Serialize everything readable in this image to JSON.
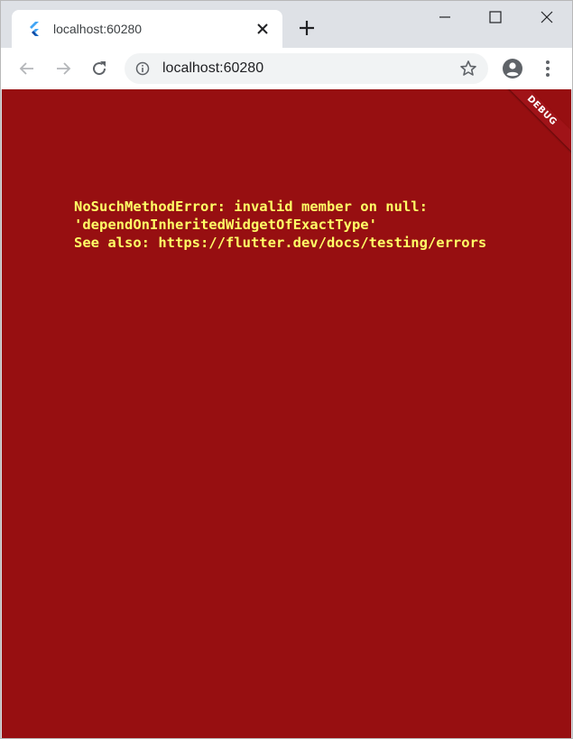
{
  "browser": {
    "tab": {
      "title": "localhost:60280",
      "favicon": "flutter-logo-icon",
      "close_icon": "close-icon"
    },
    "new_tab_icon": "plus-icon",
    "window_controls": {
      "minimize_icon": "minimize-icon",
      "maximize_icon": "maximize-icon",
      "close_icon": "close-icon"
    },
    "toolbar": {
      "back_icon": "arrow-left-icon",
      "forward_icon": "arrow-right-icon",
      "reload_icon": "reload-icon",
      "site_info_icon": "info-icon",
      "url": "localhost:60280",
      "bookmark_icon": "star-icon",
      "profile_icon": "account-circle-icon",
      "menu_icon": "more-vertical-icon"
    }
  },
  "page": {
    "background_color": "#970f11",
    "text_color": "#ffff66",
    "error_lines": [
      "NoSuchMethodError: invalid member on null:",
      "'dependOnInheritedWidgetOfExactType'",
      "See also: https://flutter.dev/docs/testing/errors"
    ],
    "debug_banner": "DEBUG"
  }
}
